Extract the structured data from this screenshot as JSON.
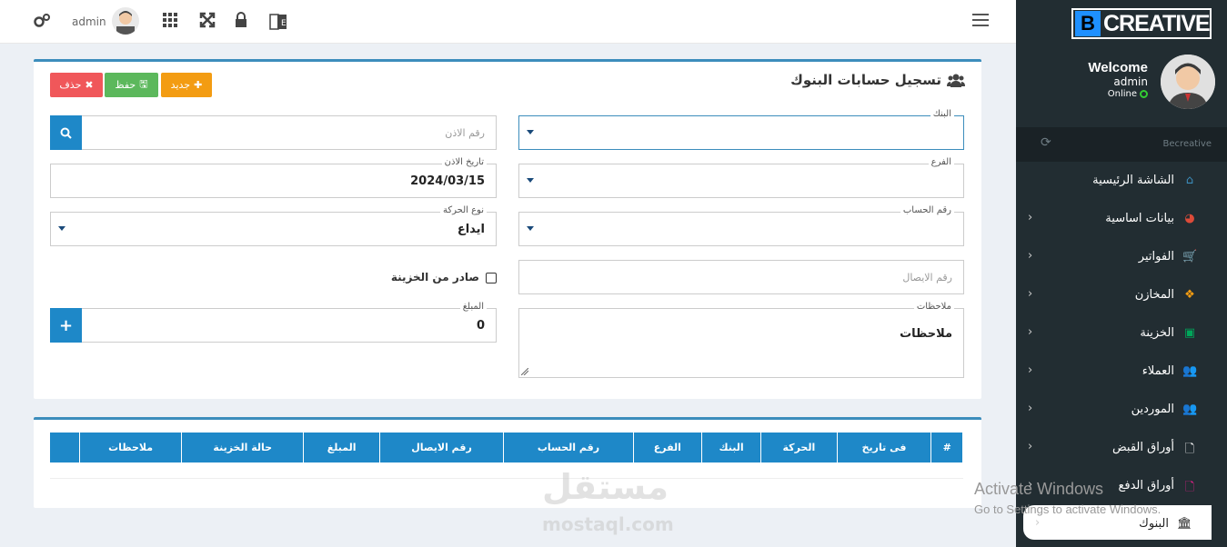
{
  "topbar": {
    "user_label": "admin",
    "icons": [
      "gears-icon",
      "avatar",
      "grid-icon",
      "expand-icon",
      "lock-icon",
      "language-icon",
      "hamburger-icon"
    ]
  },
  "brand": {
    "logo_letter": "B",
    "logo_text": "CREATIVE",
    "accent": "#1e90ff"
  },
  "sidebar": {
    "welcome": "Welcome",
    "user": "admin",
    "status": "Online",
    "search_label": "Becreative",
    "items": [
      {
        "label": "الشاشة الرئيسية",
        "icon": "home-icon",
        "color": "#3c8dbc",
        "chevron": false
      },
      {
        "label": "بيانات اساسية",
        "icon": "pie-chart-icon",
        "color": "#dd4b39",
        "chevron": true
      },
      {
        "label": "الفواتير",
        "icon": "cart-icon",
        "color": "#00c0ef",
        "chevron": true
      },
      {
        "label": "المخازن",
        "icon": "cubes-icon",
        "color": "#f39c12",
        "chevron": true
      },
      {
        "label": "الخزينة",
        "icon": "money-icon",
        "color": "#00a65a",
        "chevron": true
      },
      {
        "label": "العملاء",
        "icon": "users-icon",
        "color": "#f39c12",
        "chevron": true
      },
      {
        "label": "الموردين",
        "icon": "users-icon",
        "color": "#aaa",
        "chevron": true
      },
      {
        "label": "أوراق القبض",
        "icon": "file-icon",
        "color": "#fff",
        "chevron": true
      },
      {
        "label": "أوراق الدفع",
        "icon": "file-icon",
        "color": "#e91e8c",
        "chevron": true
      },
      {
        "label": "البنوك",
        "icon": "bank-icon",
        "color": "#222",
        "chevron": true
      }
    ]
  },
  "form": {
    "title": "تسجيل حسابات البنوك",
    "buttons": {
      "new": "جديد",
      "save": "حفظ",
      "delete": "حذف"
    },
    "bank": {
      "legend": "البنك",
      "value": ""
    },
    "branch": {
      "legend": "الفرع",
      "value": ""
    },
    "account_no": {
      "legend": "رقم الحساب",
      "value": ""
    },
    "receipt_no": {
      "placeholder": "رقم الايصال"
    },
    "notes": {
      "legend": "ملاحظات",
      "value": "ملاحظات"
    },
    "permit_no": {
      "placeholder": "رقم الاذن"
    },
    "permit_date": {
      "legend": "تاريخ الاذن",
      "value": "2024/03/15"
    },
    "movement_type": {
      "legend": "نوع الحركة",
      "value": "ايداع"
    },
    "from_treasury": {
      "label": "صادر من الخزينة",
      "checked": false
    },
    "amount": {
      "legend": "المبلغ",
      "value": "0"
    }
  },
  "table": {
    "headers": [
      "#",
      "فى تاريخ",
      "الحركة",
      "البنك",
      "الفرع",
      "رقم الحساب",
      "رقم الايصال",
      "المبلغ",
      "حالة الخزينة",
      "ملاحظات",
      ""
    ]
  },
  "overlay": {
    "watermark": "مستقل",
    "watermark_sub": "mostaql.com",
    "activate_title": "Activate Windows",
    "activate_sub": "Go to Settings to activate Windows."
  }
}
